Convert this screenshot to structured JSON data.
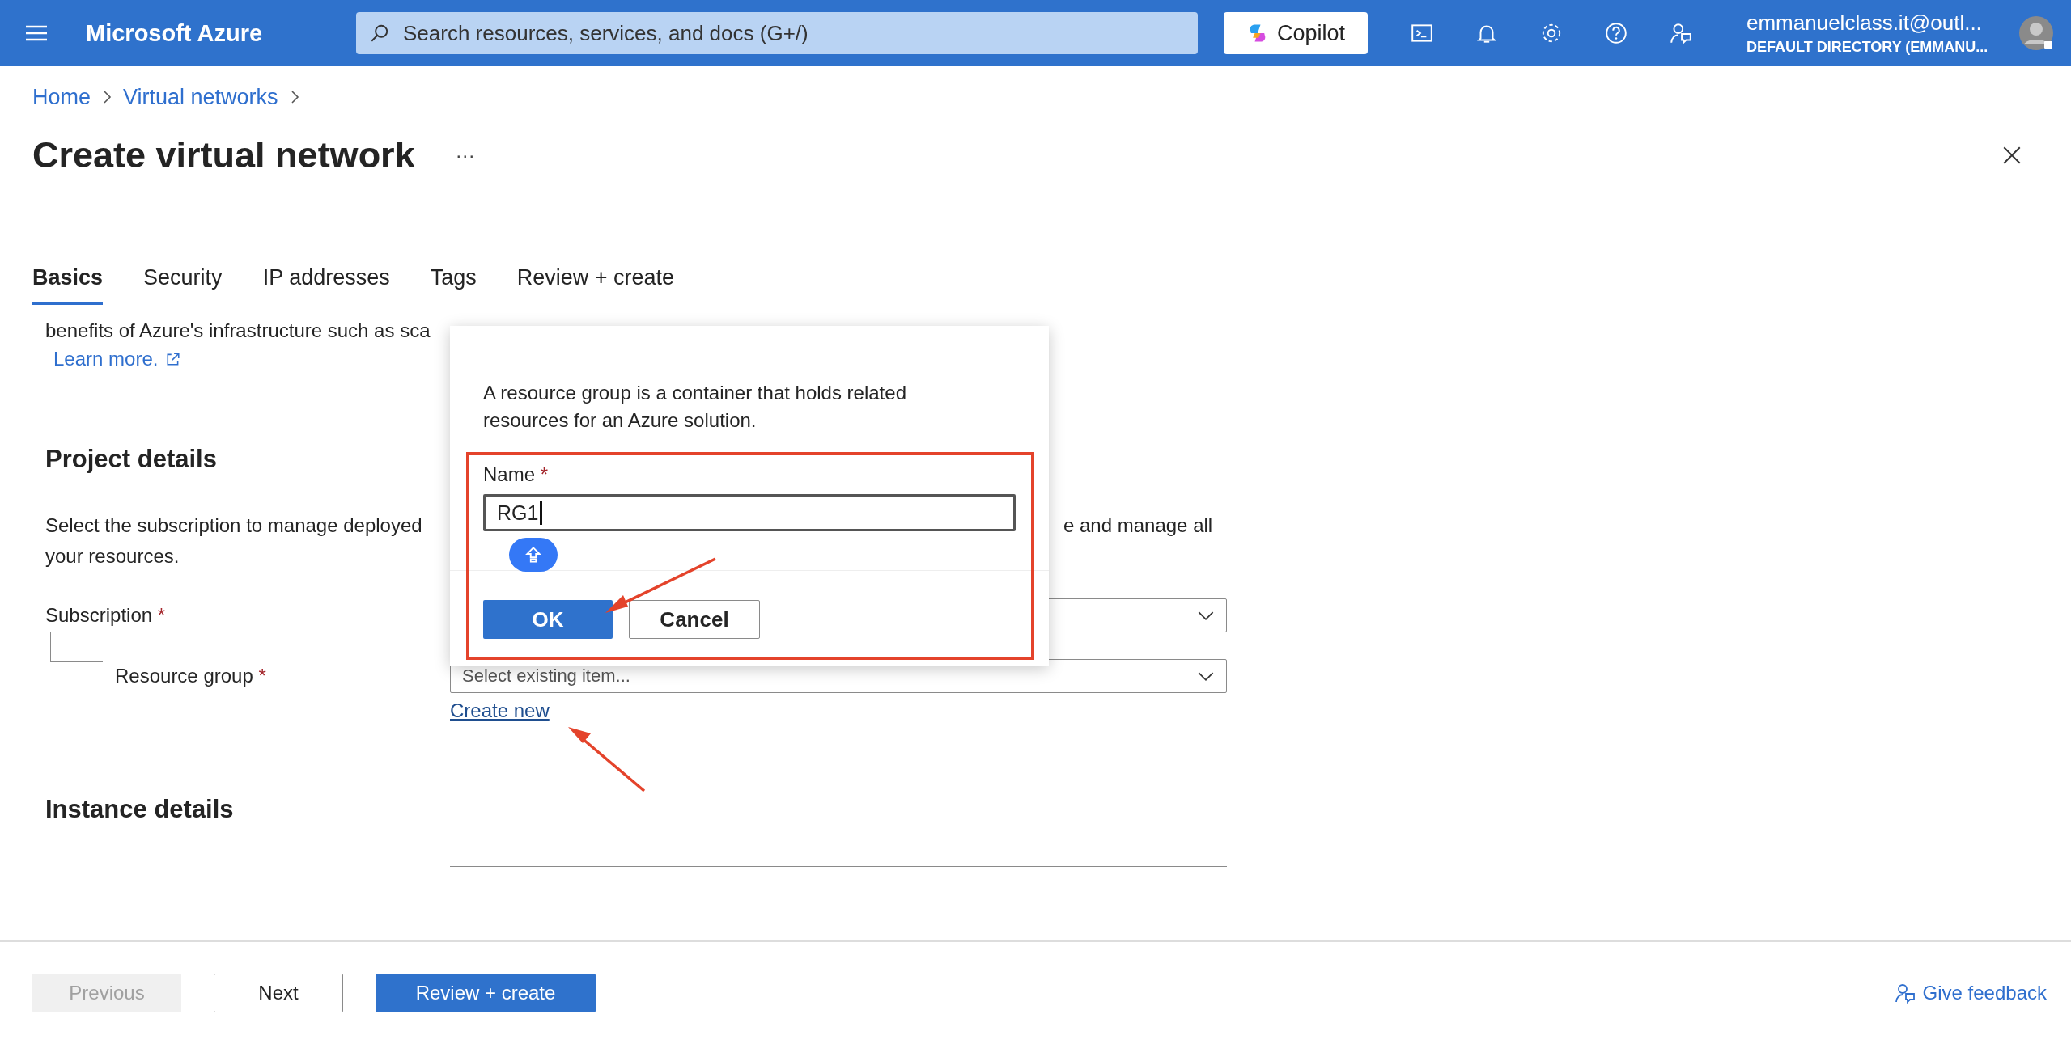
{
  "top_bar": {
    "brand": "Microsoft Azure",
    "search": {
      "placeholder": "Search resources, services, and docs (G+/)"
    },
    "copilot": "Copilot",
    "account": {
      "email": "emmanuelclass.it@outl...",
      "directory": "DEFAULT DIRECTORY (EMMANU..."
    }
  },
  "breadcrumb": [
    "Home",
    "Virtual networks"
  ],
  "page_title": "Create virtual network",
  "more_actions": "···",
  "tabs": [
    {
      "label": "Basics",
      "selected": true
    },
    {
      "label": "Security",
      "selected": false
    },
    {
      "label": "IP addresses",
      "selected": false
    },
    {
      "label": "Tags",
      "selected": false
    },
    {
      "label": "Review + create",
      "selected": false
    }
  ],
  "intro": {
    "text_cut": "benefits of Azure's infrastructure such as sca",
    "link": "Learn more."
  },
  "project_details": {
    "heading": "Project details",
    "description_left": "Select the subscription to manage deployed",
    "description_right": "e and manage all",
    "description_line2": "your resources.",
    "subscription_label": "Subscription",
    "resource_group_label": "Resource group",
    "required_mark": "*",
    "resource_group_placeholder": "Select existing item...",
    "create_new": "Create new"
  },
  "instance_details": {
    "heading": "Instance details"
  },
  "dialog": {
    "description": "A resource group is a container that holds related resources for an Azure solution.",
    "name_label": "Name",
    "required_mark": "*",
    "name_value": "RG1",
    "ok": "OK",
    "cancel": "Cancel"
  },
  "footer": {
    "previous": {
      "label": "Previous",
      "disabled": true
    },
    "next": "Next",
    "review_create": "Review + create",
    "feedback": "Give feedback"
  }
}
